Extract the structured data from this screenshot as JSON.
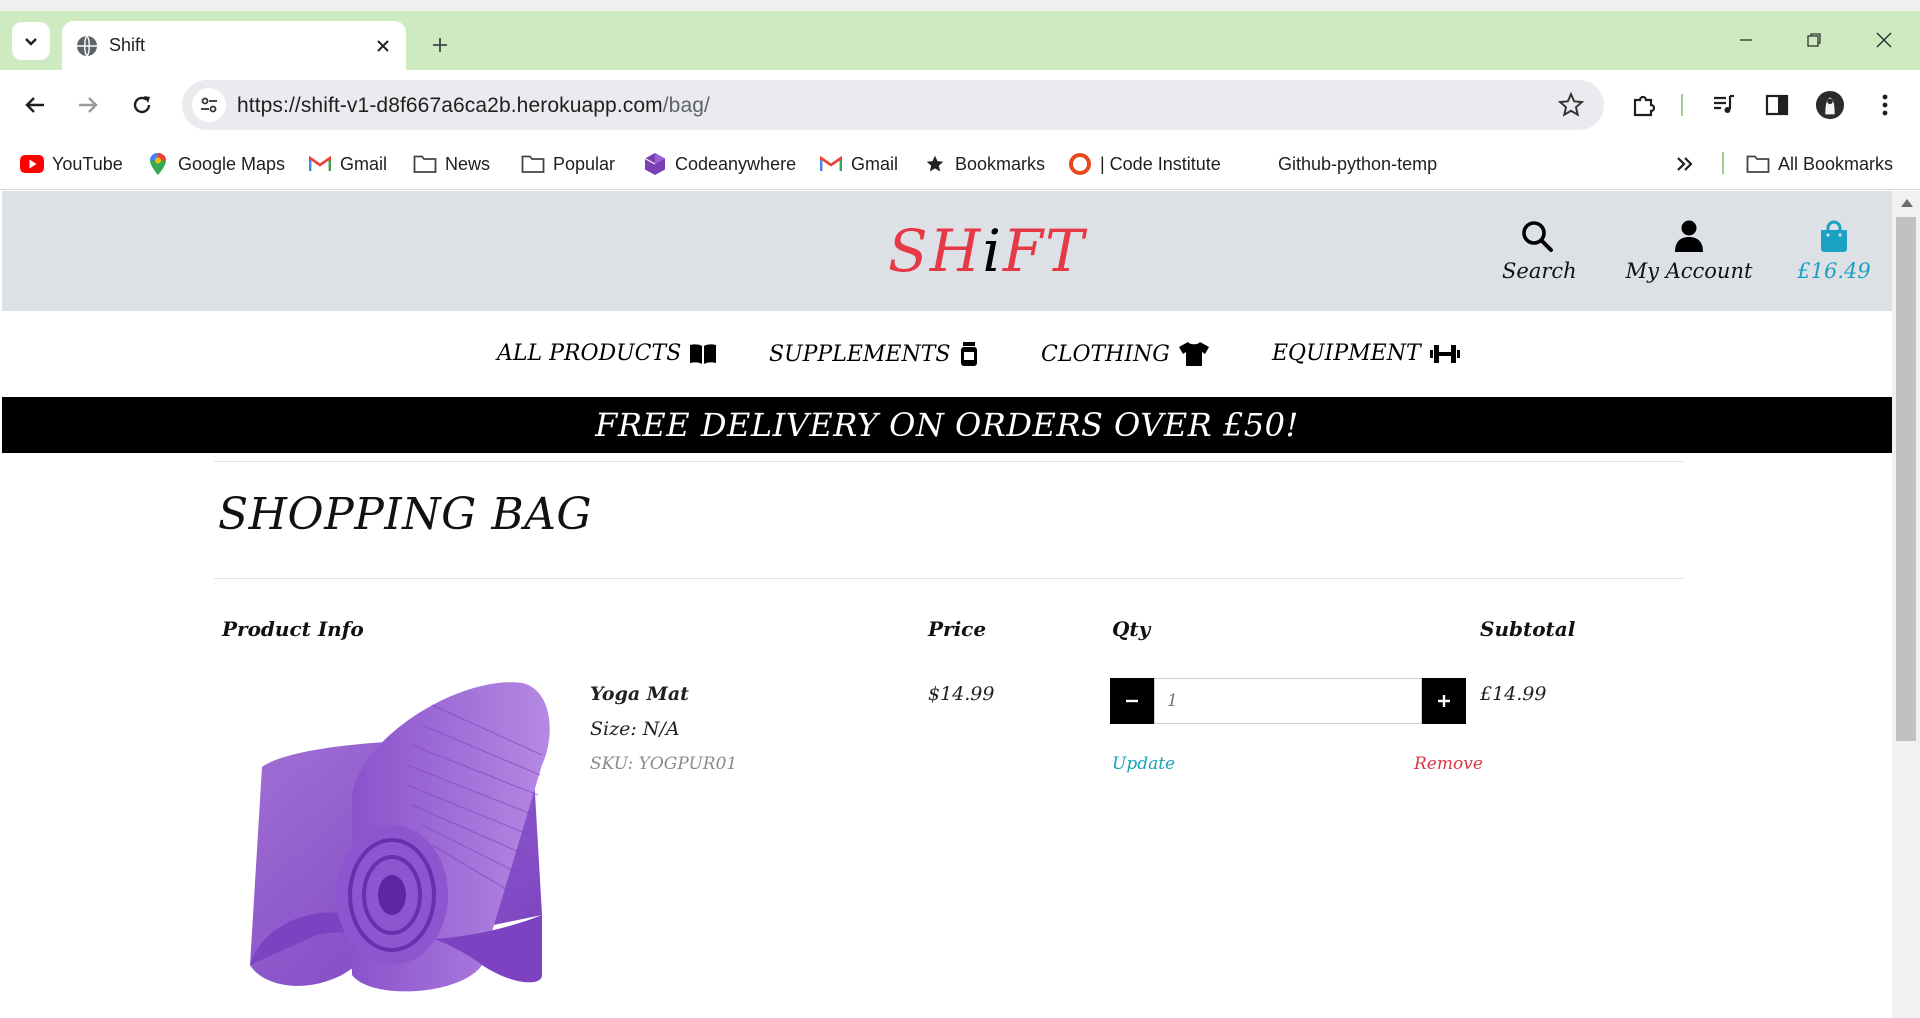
{
  "browser": {
    "tab_title": "Shift",
    "url_host": "https://shift-v1-d8f667a6ca2b.herokuapp.com",
    "url_path": "/bag/",
    "bookmarks": [
      {
        "label": "YouTube",
        "icon": "youtube-icon"
      },
      {
        "label": "Google Maps",
        "icon": "google-maps-icon"
      },
      {
        "label": "Gmail",
        "icon": "gmail-icon"
      },
      {
        "label": "News",
        "icon": "folder-icon"
      },
      {
        "label": "Popular",
        "icon": "folder-icon"
      },
      {
        "label": "Codeanywhere",
        "icon": "codeanywhere-icon"
      },
      {
        "label": "Gmail",
        "icon": "gmail-icon"
      },
      {
        "label": "Bookmarks",
        "icon": "star-icon"
      },
      {
        "label": "| Code Institute",
        "icon": "code-institute-icon"
      },
      {
        "label": "Github-python-temp",
        "icon": ""
      }
    ],
    "all_bookmarks": "All Bookmarks",
    "tab_bar_color": "#cdeac0"
  },
  "site": {
    "logo_parts": [
      "SH",
      "i",
      "FT"
    ],
    "header": {
      "search_label": "Search",
      "account_label": "My Account",
      "bag_total": "£16.49"
    },
    "nav": [
      {
        "label": "ALL PRODUCTS",
        "icon": "book-open-icon"
      },
      {
        "label": "SUPPLEMENTS",
        "icon": "jar-icon"
      },
      {
        "label": "CLOTHING",
        "icon": "tshirt-icon"
      },
      {
        "label": "EQUIPMENT",
        "icon": "dumbbell-icon"
      }
    ],
    "banner": "FREE DELIVERY ON ORDERS OVER £50!",
    "colors": {
      "logo": "#e63946",
      "bag": "#1aa1c4",
      "header_bg": "#dde1e6",
      "update": "#17a2b8",
      "remove": "#dc3545"
    }
  },
  "bag": {
    "title": "SHOPPING BAG",
    "columns": {
      "product": "Product Info",
      "price": "Price",
      "qty": "Qty",
      "subtotal": "Subtotal"
    },
    "item": {
      "name": "Yoga Mat",
      "size": "Size: N/A",
      "sku": "SKU: YOGPUR01",
      "price": "$14.99",
      "quantity": "1",
      "subtotal": "£14.99",
      "update_label": "Update",
      "remove_label": "Remove"
    }
  }
}
